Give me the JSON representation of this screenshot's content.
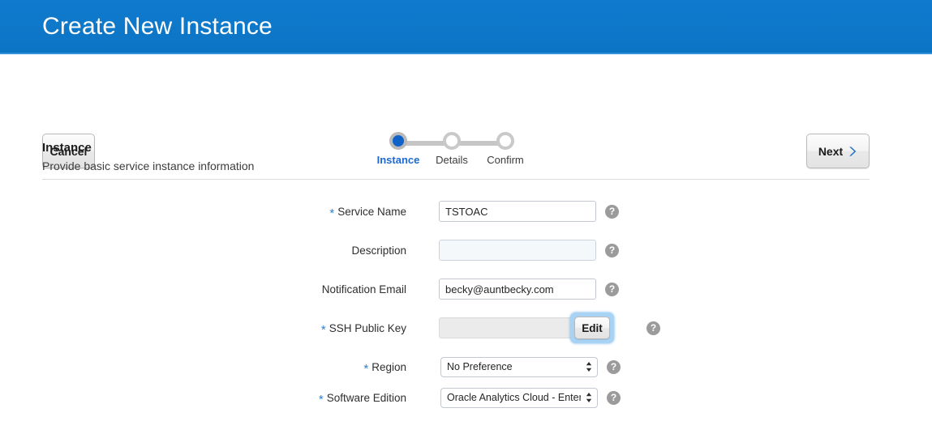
{
  "header": {
    "title": "Create New Instance",
    "background_color": "#0d74c4"
  },
  "toolbar": {
    "cancel_label": "Cancel",
    "next_label": "Next",
    "next_icon": "chevron-right-icon",
    "next_icon_color": "#1d6fc4"
  },
  "train": {
    "steps": [
      {
        "label": "Instance",
        "state": "active"
      },
      {
        "label": "Details",
        "state": "inactive"
      },
      {
        "label": "Confirm",
        "state": "inactive"
      }
    ],
    "active_color": "#0f62c8",
    "inactive_color": "#c9c9c9"
  },
  "section": {
    "title": "Instance",
    "subtitle": "Provide basic service instance information"
  },
  "form": {
    "required_marker": "*",
    "help_icon": "help-question-icon",
    "fields": [
      {
        "label": "Service Name",
        "required": true,
        "type": "text",
        "value": "TSTOAC",
        "placeholder": ""
      },
      {
        "label": "Description",
        "required": false,
        "type": "text",
        "value": "",
        "placeholder": ""
      },
      {
        "label": "Notification Email",
        "required": false,
        "type": "text",
        "value": "becky@auntbecky.com",
        "placeholder": ""
      },
      {
        "label": "SSH Public Key",
        "required": true,
        "type": "disabled-text-with-button",
        "value": "",
        "button_label": "Edit",
        "button_focused": true
      },
      {
        "label": "Region",
        "required": true,
        "type": "select",
        "value": "No Preference"
      },
      {
        "label": "Software Edition",
        "required": true,
        "type": "select",
        "value": "Oracle Analytics Cloud - Enterprise Edition"
      }
    ]
  }
}
